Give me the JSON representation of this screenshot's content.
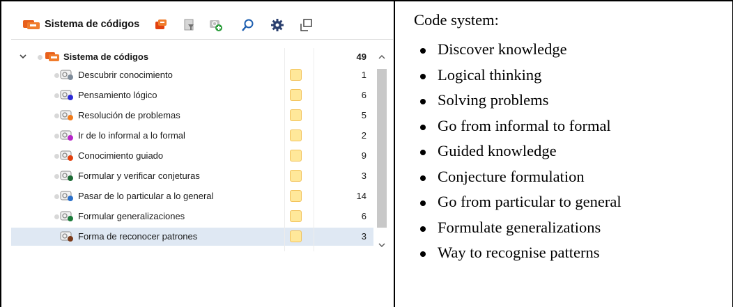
{
  "toolbar": {
    "title": "Sistema de códigos",
    "icons": [
      "code-system-icon",
      "new-code-icon",
      "filter-icon",
      "add-code-icon",
      "search-icon",
      "gear-icon",
      "undock-window-icon"
    ]
  },
  "tree": {
    "root": {
      "label": "Sistema de códigos",
      "count": "49"
    },
    "items": [
      {
        "label": "Descubrir conocimiento",
        "count": "1",
        "color": "#7f8c9a"
      },
      {
        "label": "Pensamiento lógico",
        "count": "6",
        "color": "#2b2bd6"
      },
      {
        "label": "Resolución de problemas",
        "count": "5",
        "color": "#f07c1c"
      },
      {
        "label": "Ir de lo informal a lo formal",
        "count": "2",
        "color": "#b626c9"
      },
      {
        "label": "Conocimiento guiado",
        "count": "9",
        "color": "#e2410f"
      },
      {
        "label": "Formular y verificar conjeturas",
        "count": "3",
        "color": "#1d6b35"
      },
      {
        "label": "Pasar de lo particular a lo general",
        "count": "14",
        "color": "#2a6fc9"
      },
      {
        "label": "Formular generalizaciones",
        "count": "6",
        "color": "#1b7b3a"
      },
      {
        "label": "Forma de reconocer patrones",
        "count": "3",
        "color": "#7a3a1a"
      }
    ],
    "selected_index": 8
  },
  "notes": {
    "heading": "Code system:",
    "items": [
      "Discover knowledge",
      "Logical thinking",
      "Solving problems",
      "Go from informal to formal",
      "Guided knowledge",
      "Conjecture formulation",
      "Go from particular to general",
      "Formulate generalizations",
      "Way to recognise patterns"
    ]
  },
  "colors": {
    "accent": "#e85a1a",
    "selection": "#dfe8f3",
    "memo": "#ffe89a"
  }
}
